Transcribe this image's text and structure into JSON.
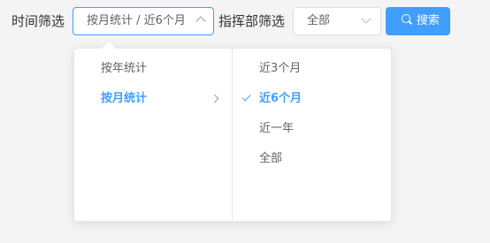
{
  "filters": {
    "time_label": "时间筛选",
    "cascader_value": "按月统计 / 近6个月",
    "command_label": "指挥部筛选",
    "command_value": "全部",
    "search_label": "搜索"
  },
  "dropdown": {
    "primary": [
      {
        "label": "按年统计",
        "active": false
      },
      {
        "label": "按月统计",
        "active": true
      }
    ],
    "secondary": [
      {
        "label": "近3个月",
        "active": false
      },
      {
        "label": "近6个月",
        "active": true
      },
      {
        "label": "近一年",
        "active": false
      },
      {
        "label": "全部",
        "active": false
      }
    ]
  },
  "colors": {
    "accent": "#409eff",
    "border": "#dcdfe6",
    "text": "#606266"
  },
  "icons": {
    "search": "search-icon",
    "expand": "chevron-right-icon",
    "selected": "check-icon"
  }
}
